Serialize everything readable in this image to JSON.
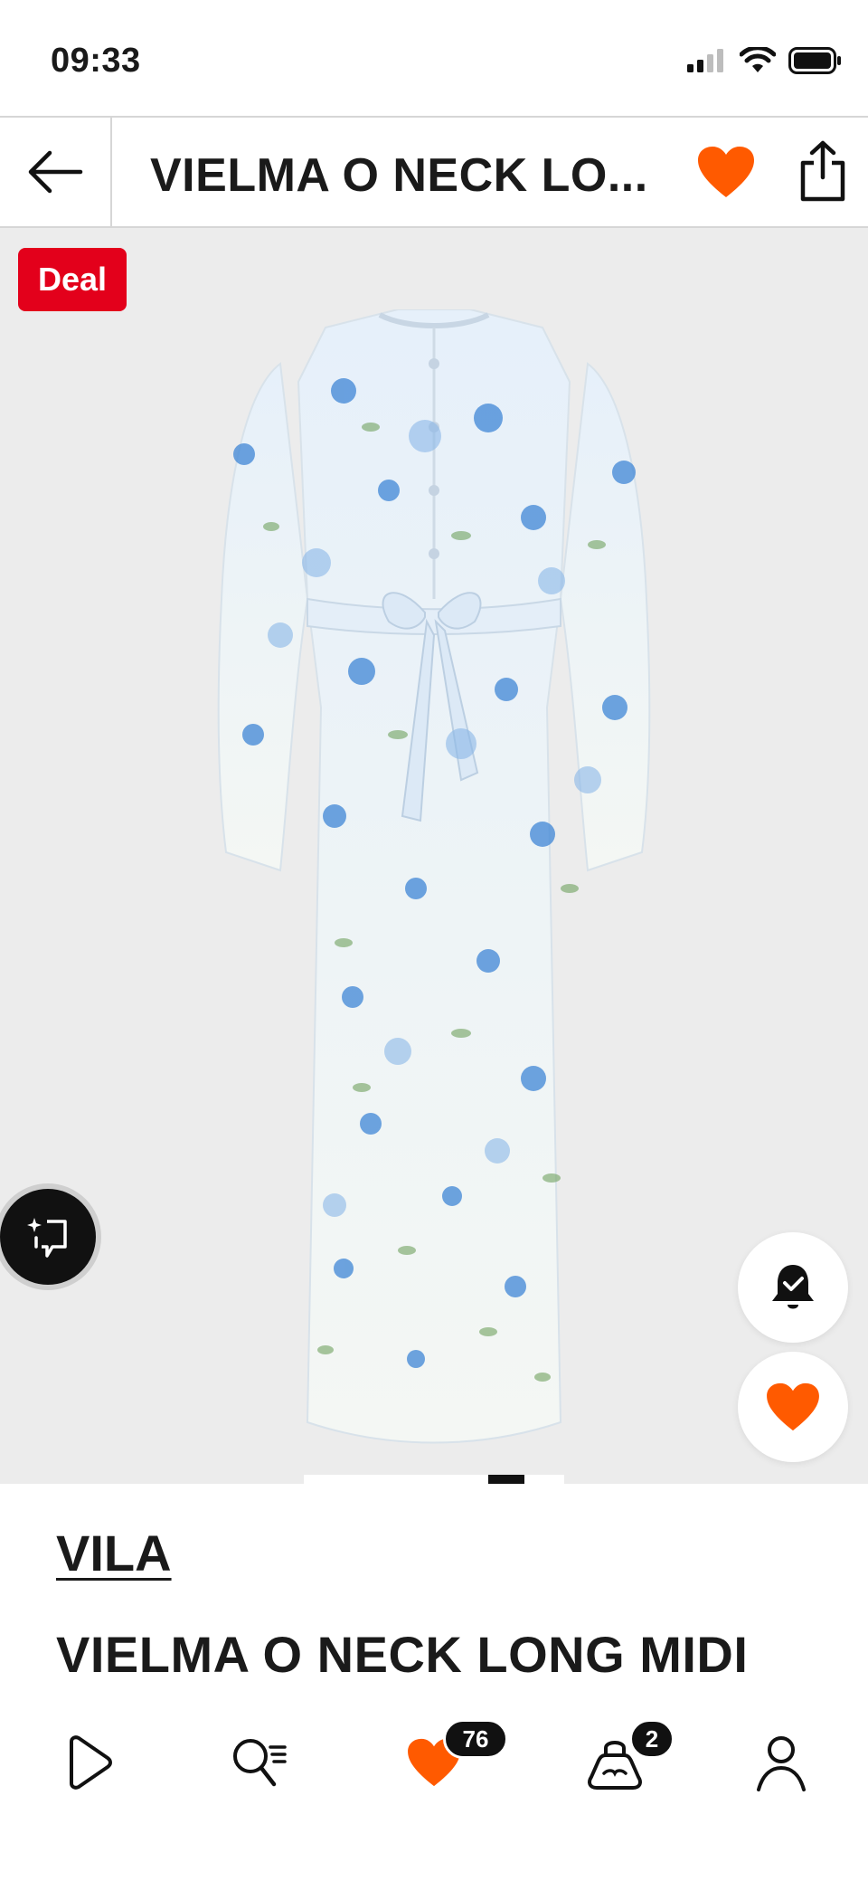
{
  "status_bar": {
    "time": "09:33"
  },
  "header": {
    "title": "VIELMA O NECK LO..."
  },
  "gallery": {
    "badge": "Deal",
    "current_image": 5,
    "image_count": 5
  },
  "product": {
    "brand": "VILA",
    "name": "VIELMA O NECK LONG MIDI"
  },
  "tab_bar": {
    "items": [
      {
        "name": "play",
        "icon": "play-icon"
      },
      {
        "name": "search",
        "icon": "search-list-icon"
      },
      {
        "name": "wishlist",
        "icon": "heart-icon",
        "count": "76"
      },
      {
        "name": "bag",
        "icon": "bag-icon",
        "count": "2"
      },
      {
        "name": "account",
        "icon": "user-icon"
      }
    ]
  },
  "colors": {
    "accent": "#ff5a00",
    "deal": "#e3001b",
    "text": "#1a1a1a"
  }
}
